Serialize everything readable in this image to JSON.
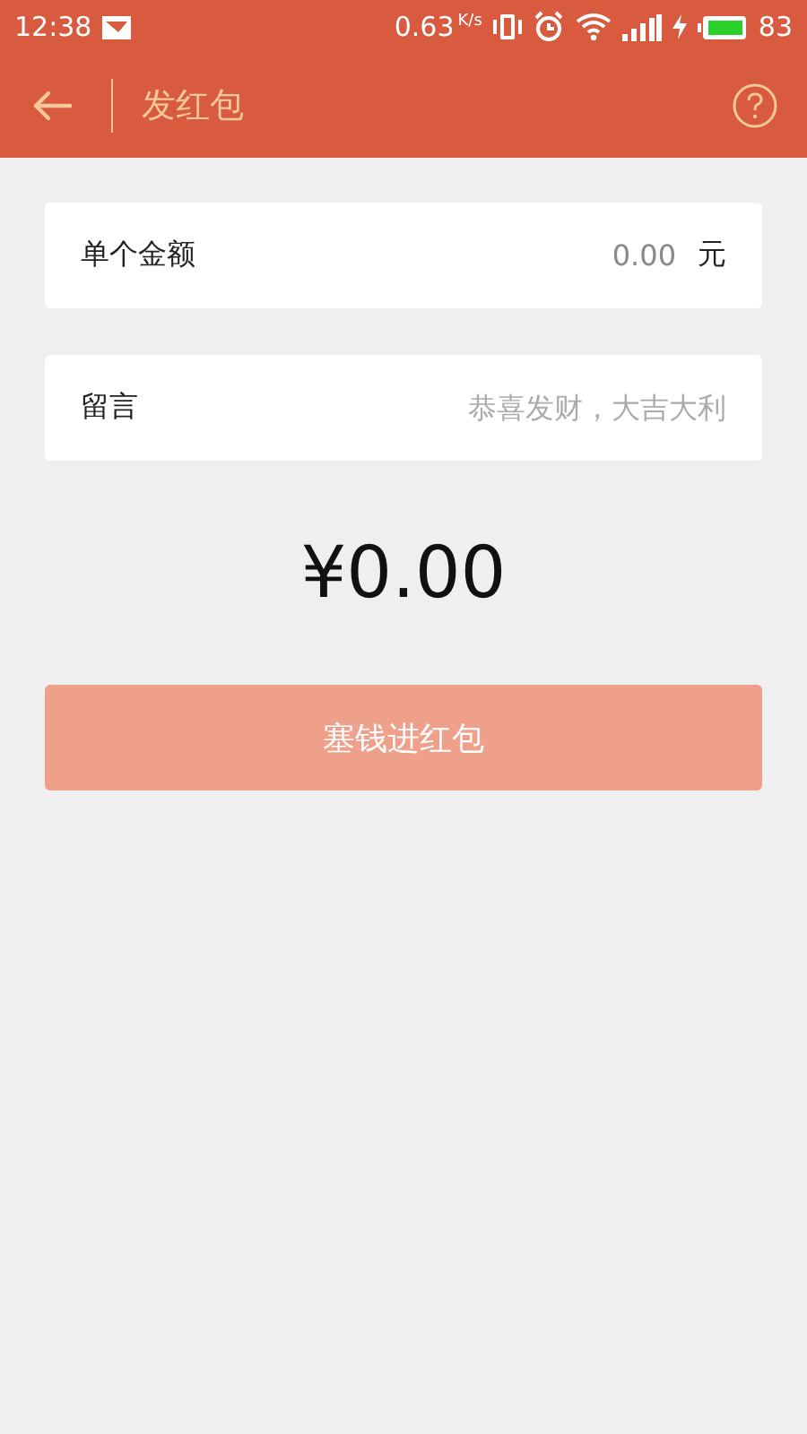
{
  "status_bar": {
    "time": "12:38",
    "speed": "0.63",
    "speed_unit": "K/s",
    "battery": "83"
  },
  "header": {
    "title": "发红包"
  },
  "fields": [
    {
      "kind": "amount",
      "label": "单个金额",
      "placeholder": "0.00",
      "unit": "元"
    },
    {
      "kind": "message",
      "label": "留言",
      "placeholder": "恭喜发财，大吉大利"
    }
  ],
  "total": "¥0.00",
  "submit": {
    "label": "塞钱进红包",
    "disabled": true
  }
}
